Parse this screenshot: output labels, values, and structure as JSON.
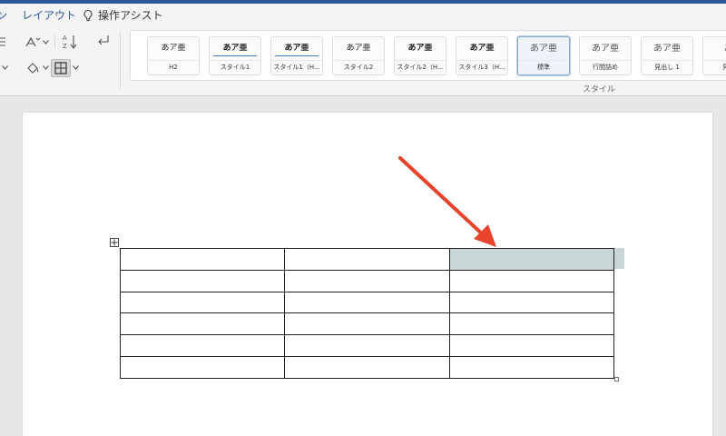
{
  "tabs": {
    "partial": "ン",
    "layout": "レイアウト",
    "assist": "操作アシスト"
  },
  "ribbon": {
    "group_label": "スタイル",
    "styles": [
      {
        "sample": "あア亜",
        "name": "H2",
        "bold": false
      },
      {
        "sample": "あア亜",
        "name": "スタイル1",
        "bold": true
      },
      {
        "sample": "あア亜",
        "name": "スタイル1（H...",
        "bold": true
      },
      {
        "sample": "あア亜",
        "name": "スタイル2",
        "bold": false
      },
      {
        "sample": "あア亜",
        "name": "スタイル2（H...",
        "bold": true
      },
      {
        "sample": "あア亜",
        "name": "スタイル3（H...",
        "bold": true
      },
      {
        "sample": "あア亜",
        "name": "標準",
        "bold": false,
        "selected": true
      },
      {
        "sample": "あア亜",
        "name": "行間詰め",
        "bold": false
      },
      {
        "sample": "あア亜",
        "name": "見出し 1",
        "bold": false
      },
      {
        "sample": "あ",
        "name": "見出",
        "bold": false
      }
    ]
  },
  "table": {
    "rows": 6,
    "cols": 3,
    "selected_cell": {
      "row": 1,
      "col": 3
    }
  },
  "colors": {
    "accent_blue": "#2b579a",
    "selection": "#c8d6d5",
    "arrow_red": "#e8432d"
  }
}
